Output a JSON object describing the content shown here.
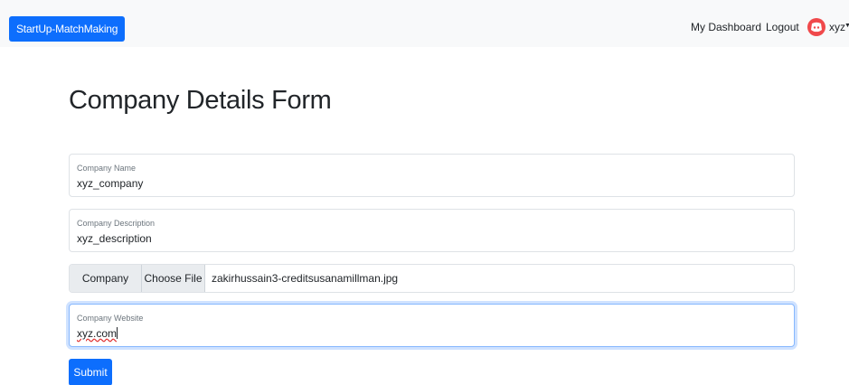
{
  "navbar": {
    "brand": "StartUp-MatchMaking",
    "links": [
      "My Dashboard",
      "Logout"
    ],
    "user": {
      "name": "xyz",
      "avatar_icon": "discord-icon",
      "avatar_color": "#f0494b"
    }
  },
  "form": {
    "title": "Company Details Form",
    "company_name": {
      "label": "Company Name",
      "value": "xyz_company"
    },
    "company_description": {
      "label": "Company Description",
      "value": "xyz_description"
    },
    "company_logo": {
      "label": "Company Logo",
      "button": "Choose File",
      "filename": "zakirhussain3-creditsusanamillman.jpg"
    },
    "company_website": {
      "label": "Company Website",
      "value": "xyz.com"
    },
    "submit": "Submit"
  },
  "colors": {
    "primary": "#0d6efd",
    "navbar_bg": "#f8f9fa"
  }
}
